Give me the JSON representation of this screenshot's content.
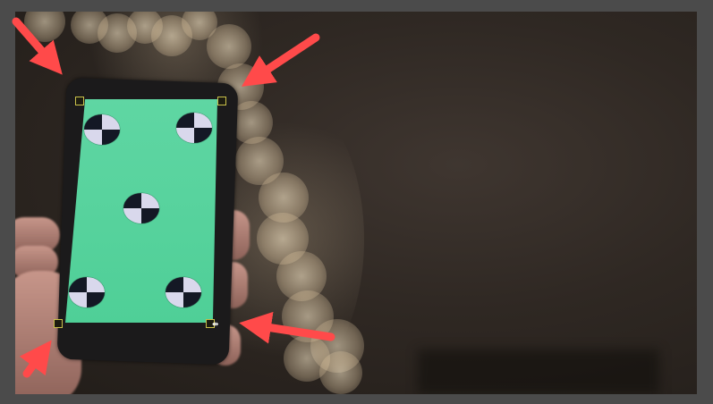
{
  "viewer": {
    "frame_color": "#4b4b4b"
  },
  "video_frame": {
    "subject": "phone",
    "screen_color": "#55d29c",
    "marker_count": 5
  },
  "arrows": {
    "color": "#ff4a4a"
  },
  "handles": {
    "color": "#c9c04a"
  },
  "cursor": {
    "icon": "move-cursor-icon"
  }
}
